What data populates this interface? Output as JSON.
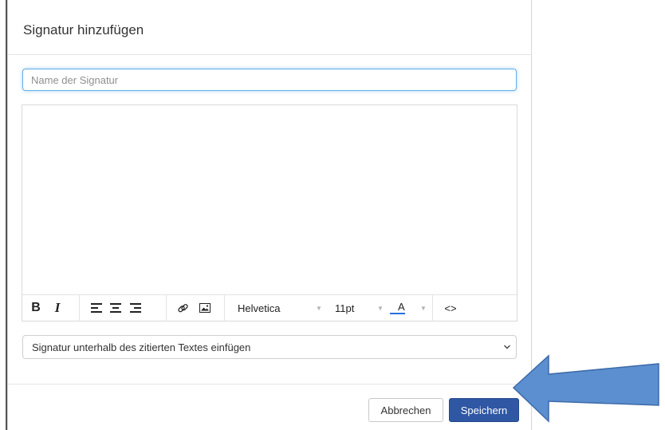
{
  "modal": {
    "title": "Signatur hinzufügen",
    "name_field": {
      "value": "",
      "placeholder": "Name der Signatur"
    },
    "editor": {
      "content": "",
      "toolbar": {
        "bold": "B",
        "italic": "I",
        "font_family": "Helvetica",
        "font_size": "11pt",
        "text_color": "A",
        "source_code": "<>"
      }
    },
    "placement_select": {
      "selected": "Signatur unterhalb des zitierten Textes einfügen"
    },
    "buttons": {
      "cancel": "Abbrechen",
      "save": "Speichern"
    }
  },
  "colors": {
    "primary": "#2f57a4",
    "input_focus": "#66afe9",
    "annotation_arrow": "#5b8fd0",
    "text_color_underline": "#2a6fdb"
  }
}
